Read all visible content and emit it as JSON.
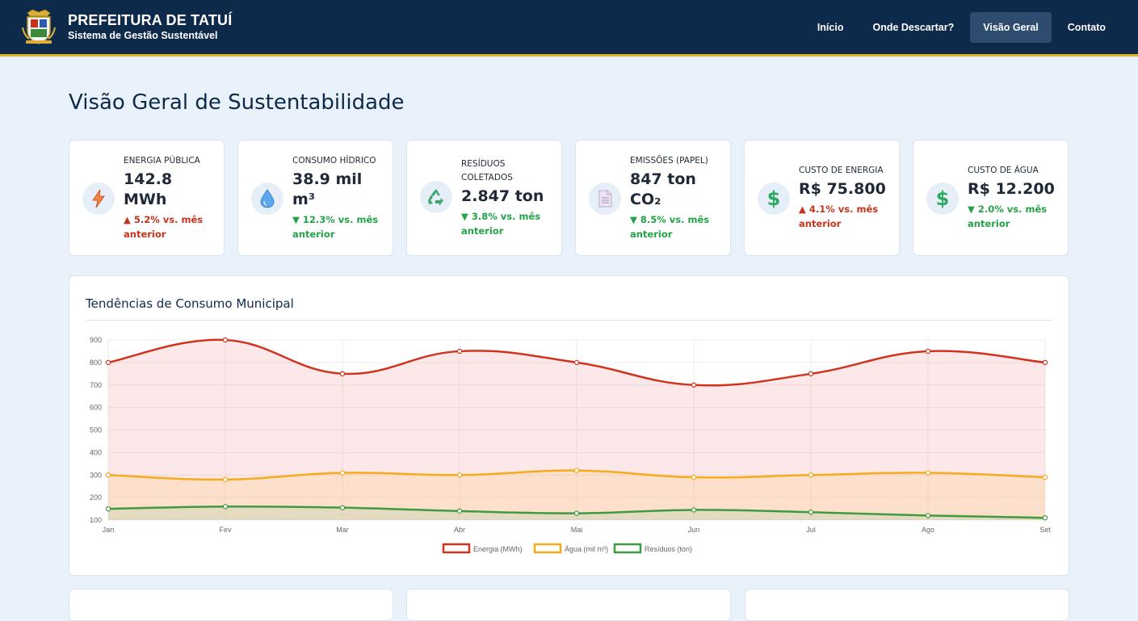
{
  "header": {
    "title": "PREFEITURA DE TATUÍ",
    "subtitle": "Sistema de Gestão Sustentável",
    "logo_icon": "municipal-crest-icon",
    "nav": [
      {
        "label": "Início",
        "active": false
      },
      {
        "label": "Onde Descartar?",
        "active": false
      },
      {
        "label": "Visão Geral",
        "active": true
      },
      {
        "label": "Contato",
        "active": false
      }
    ]
  },
  "page": {
    "title": "Visão Geral de Sustentabilidade"
  },
  "cards": [
    {
      "icon": "lightning-icon",
      "label": "ENERGIA PÚBLICA",
      "value": "142.8 MWh",
      "delta": "▲ 5.2% vs. mês anterior",
      "trend": "up"
    },
    {
      "icon": "water-drop-icon",
      "label": "CONSUMO HÍDRICO",
      "value": "38.9 mil m³",
      "delta": "▼ 12.3% vs. mês anterior",
      "trend": "down"
    },
    {
      "icon": "recycle-icon",
      "label": "RESÍDUOS COLETADOS",
      "value": "2.847 ton",
      "delta": "▼ 3.8% vs. mês anterior",
      "trend": "down"
    },
    {
      "icon": "paper-document-icon",
      "label": "EMISSÕES (PAPEL)",
      "value": "847 ton CO₂",
      "delta": "▼ 8.5% vs. mês anterior",
      "trend": "down"
    },
    {
      "icon": "dollar-icon",
      "label": "CUSTO DE ENERGIA",
      "value": "R$ 75.800",
      "delta": "▲ 4.1% vs. mês anterior",
      "trend": "up"
    },
    {
      "icon": "dollar-icon",
      "label": "CUSTO DE ÁGUA",
      "value": "R$ 12.200",
      "delta": "▼ 2.0% vs. mês anterior",
      "trend": "down"
    }
  ],
  "colors": {
    "navy": "#0e2a4a",
    "gold": "#e3b22a",
    "up": "#c8321b",
    "down": "#22a347"
  },
  "chart_data": {
    "type": "area",
    "title": "Tendências de Consumo Municipal",
    "categories": [
      "Jan",
      "Fev",
      "Mar",
      "Abr",
      "Mai",
      "Jun",
      "Jul",
      "Ago",
      "Set"
    ],
    "ylim": [
      100,
      900
    ],
    "yticks": [
      900,
      800,
      700,
      600,
      500,
      400,
      300,
      200,
      100
    ],
    "grid": true,
    "legend_position": "bottom",
    "series": [
      {
        "name": "Energia (MWh)",
        "color": "#d0341f",
        "fill": "rgba(240,128,128,0.18)",
        "values": [
          800,
          900,
          750,
          850,
          800,
          700,
          750,
          850,
          800
        ]
      },
      {
        "name": "Água (mil m³)",
        "color": "#f5ab1c",
        "fill": "rgba(250,200,120,0.25)",
        "values": [
          300,
          280,
          310,
          300,
          320,
          290,
          300,
          310,
          290
        ]
      },
      {
        "name": "Resíduos (ton)",
        "color": "#3f9b3f",
        "fill": "rgba(150,200,150,0.22)",
        "values": [
          150,
          160,
          155,
          140,
          130,
          145,
          135,
          120,
          110
        ]
      }
    ]
  }
}
